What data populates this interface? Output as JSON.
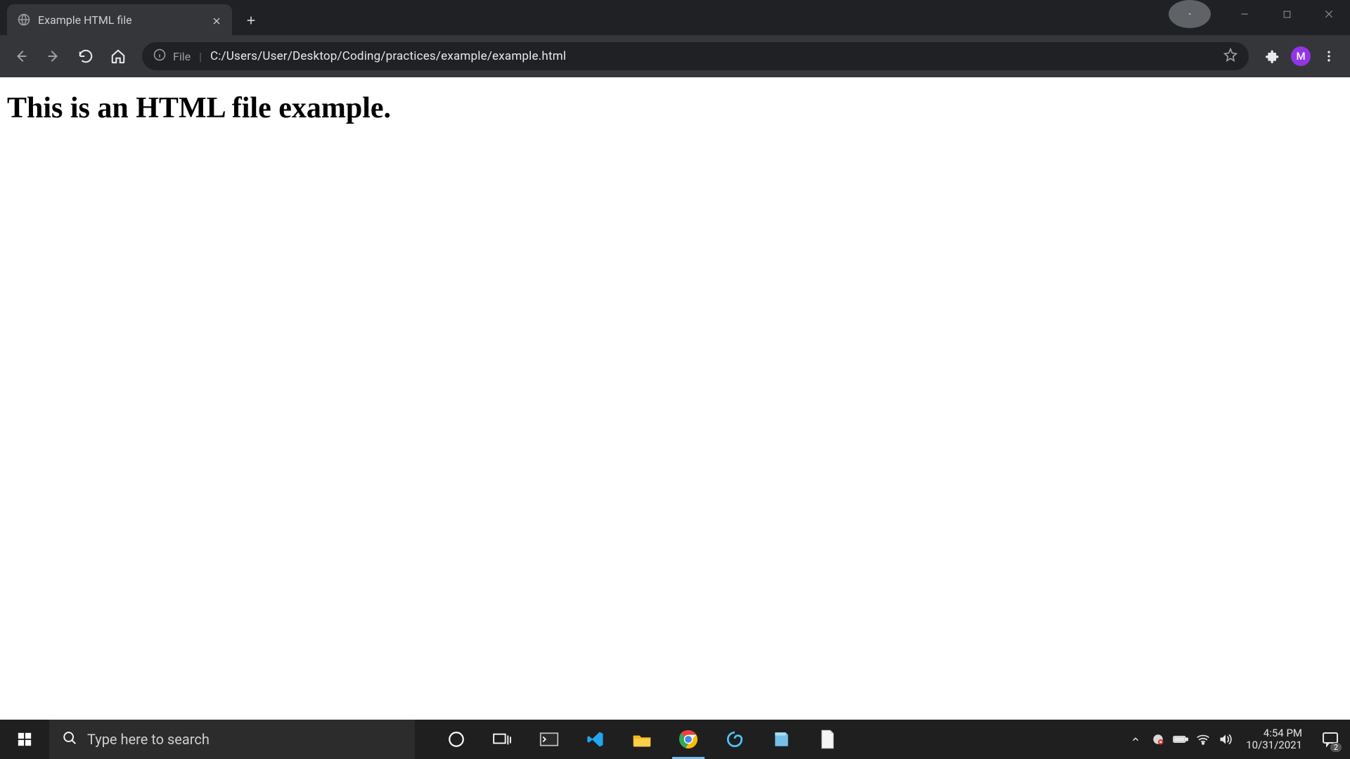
{
  "browser": {
    "tab": {
      "title": "Example HTML file"
    },
    "address": {
      "scheme": "File",
      "path": "C:/Users/User/Desktop/Coding/practices/example/example.html"
    },
    "avatar_initial": "M"
  },
  "page": {
    "heading": "This is an HTML file example."
  },
  "taskbar": {
    "search_placeholder": "Type here to search",
    "time": "4:54 PM",
    "date": "10/31/2021",
    "action_center_count": "2"
  }
}
